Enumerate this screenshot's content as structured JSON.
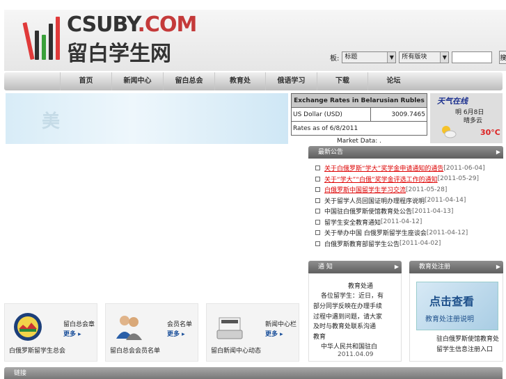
{
  "site": {
    "logo_en_main": "CSUBY",
    "logo_en_dot": ".COM",
    "logo_cn": "留白学生网"
  },
  "search": {
    "label": "板:",
    "select1_value": "标题",
    "select2_value": "所有版块",
    "button_label": "搜索"
  },
  "nav": {
    "items": [
      "首页",
      "新闻中心",
      "留白总会",
      "教育处",
      "俄语学习",
      "下载",
      "论坛"
    ]
  },
  "banner": {
    "text": "美"
  },
  "exchange": {
    "title": "Exchange Rates in Belarusian Rubles",
    "currency": "US Dollar (USD)",
    "rate": "3009.7465",
    "as_of": "Rates as of 6/8/2011",
    "market": "Market Data: ."
  },
  "weather": {
    "title": "天气在线",
    "date": "明 6月8日",
    "condition": "晴多云",
    "temp": "30°C"
  },
  "news": {
    "header": "最新公告",
    "items": [
      {
        "title": "关于白俄罗斯“学大”奖学金申请通知的通告",
        "date": "[2011-06-04]",
        "highlight": true
      },
      {
        "title": "关于“学大”“白俄”奖学金评选工作的通知",
        "date": "[2011-05-29]",
        "highlight": true
      },
      {
        "title": "白俄罗斯中国留学生学习交流",
        "date": "[2011-05-28]",
        "highlight": true
      },
      {
        "title": "关于留学人员回国证明办理程序说明",
        "date": "[2011-04-14]",
        "highlight": false
      },
      {
        "title": "中国驻白俄罗斯使馆教育处公告",
        "date": "[2011-04-13]",
        "highlight": false
      },
      {
        "title": "留学生安全教育通知",
        "date": "[2011-04-12]",
        "highlight": false
      },
      {
        "title": "关于举办中国 白俄罗斯留学生座谈会",
        "date": "[2011-04-12]",
        "highlight": false
      },
      {
        "title": "白俄罗斯教育部留学生公告",
        "date": "[2011-04-02]",
        "highlight": false
      }
    ]
  },
  "edu": {
    "header": "通  知",
    "lines": [
      "教育处通",
      "各位留学生：近日，有",
      "部分同学反映在办理手续",
      "过程中遇到问题，请大家",
      "及时与教育处联系沟通",
      "教育",
      "中华人民共和国驻白",
      "2011.04.09"
    ]
  },
  "register": {
    "header": "教育处注册",
    "img_big": "点击查看",
    "img_small": "教育处注册说明",
    "line1": "驻白俄罗斯使馆教育处",
    "line2": "留学生信息注册入口"
  },
  "cards": [
    {
      "label": "留白总会章",
      "more": "更多",
      "caption": "白俄罗斯留学生总会"
    },
    {
      "label": "会员名单",
      "more": "更多",
      "caption": "留白总会会员名单"
    },
    {
      "label": "新闻中心栏",
      "more": "更多",
      "caption": "留白新闻中心动态"
    }
  ],
  "footer": {
    "label": "链接"
  },
  "colors": {
    "accent_red": "#d00000",
    "nav_gradient_top": "#f0f0f0",
    "panel_head": "#707070",
    "link_blue": "#1a4f9a"
  }
}
